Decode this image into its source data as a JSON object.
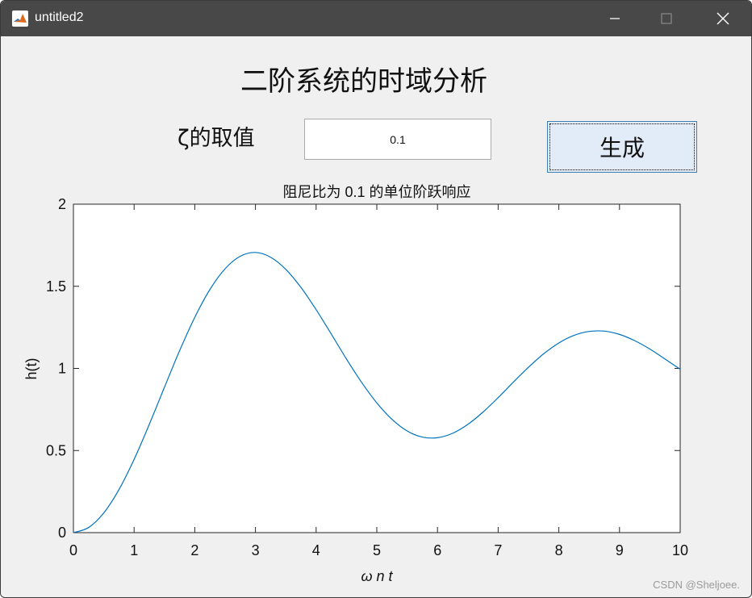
{
  "window": {
    "title": "untitled2",
    "controls": {
      "minimize": "minimize",
      "maximize": "maximize",
      "close": "close"
    }
  },
  "figure": {
    "heading": "二阶系统的时域分析",
    "zeta_label": "ζ的取值",
    "zeta_value": "0.1",
    "generate_label": "生成"
  },
  "chart_data": {
    "type": "line",
    "title": "阻尼比为 0.1 的单位阶跃响应",
    "xlabel": "ω n t",
    "ylabel": "h(t)",
    "xlim": [
      0,
      10
    ],
    "ylim": [
      0,
      2
    ],
    "xticks": [
      "0",
      "1",
      "2",
      "3",
      "4",
      "5",
      "6",
      "7",
      "8",
      "9",
      "10"
    ],
    "yticks": [
      "0",
      "0.5",
      "1",
      "1.5",
      "2"
    ],
    "grid": false,
    "line_color": "#0072bd",
    "series": [
      {
        "x": [
          0,
          0.25,
          0.5,
          0.75,
          1,
          1.25,
          1.5,
          1.75,
          2,
          2.25,
          2.5,
          2.75,
          3,
          3.25,
          3.5,
          3.75,
          4,
          4.25,
          4.5,
          4.75,
          5,
          5.25,
          5.5,
          5.75,
          6,
          6.25,
          6.5,
          6.75,
          7,
          7.25,
          7.5,
          7.75,
          8,
          8.25,
          8.5,
          8.75,
          9,
          9.25,
          9.5,
          9.75,
          10
        ],
        "y": [
          0,
          0.031,
          0.12,
          0.262,
          0.446,
          0.659,
          0.885,
          1.108,
          1.311,
          1.481,
          1.607,
          1.683,
          1.706,
          1.677,
          1.603,
          1.493,
          1.358,
          1.209,
          1.057,
          0.915,
          0.79,
          0.69,
          0.619,
          0.582,
          0.578,
          0.605,
          0.659,
          0.734,
          0.822,
          0.916,
          1.007,
          1.089,
          1.155,
          1.201,
          1.225,
          1.227,
          1.207,
          1.169,
          1.118,
          1.057,
          0.995
        ]
      }
    ]
  },
  "watermark": "CSDN @Sheljoee."
}
